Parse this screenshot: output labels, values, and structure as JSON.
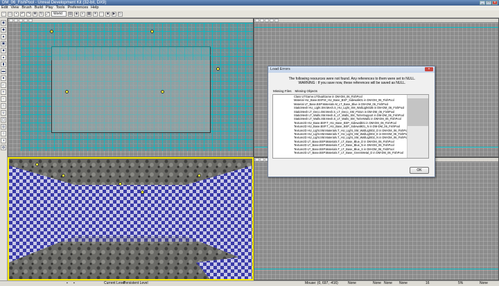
{
  "window": {
    "title": "DM_06_FishPool - Unreal Development Kit (32-bit, DX9)"
  },
  "menu": [
    "Edit",
    "View",
    "Brush",
    "Build",
    "Play",
    "Tools",
    "Preferences",
    "Help"
  ],
  "toolbar": {
    "world_select": "World"
  },
  "dialog": {
    "title": "Load Errors",
    "message_line1": "The following resources were not found. Any references to them were set to NULL.",
    "message_line2": "WARNING : If you save now, these references will be saved as NULL.",
    "tabs": [
      "Missing Files",
      "Missing Objects"
    ],
    "items": [
      "Class UTGame.UTDualGame in DM-DM_06_FishPool",
      "Material HU_Base.BSP.M_HU_Base_BSP_Sidewalk01 in DM-DM_06_FishPool",
      "Material LT_Base.BSP.Materials.M_LT_Base_Blue in DM-DM_06_FishPool",
      "StaticMesh HU_Light.SM.Mesh.S_HU_Light_SM_WallLight02B in DM-DM_06_FishPool",
      "StaticMesh LT_Deco.SM.Mesh.S_LT_Deco_SM_Piston in DM-DM_06_FishPool",
      "StaticMesh LT_Walls.SM.Mesh.S_LT_Walls_SM_TorlerSupport in DM-DM_06_FishPool",
      "StaticMesh LT_Walls.SM.Mesh.S_LT_Walls_SM_TorlerWall1 in DM-DM_06_FishPool",
      "Texture2D HU_Base.BSP.T_HU_Base_BSP_Sidewalk01 in DM-DM_06_FishPool",
      "Texture2D HU_Base.BSP.T_HU_Base_BSP_Sidewalk01_N in DM-DM_06_FishPool",
      "Texture2D HU_Light.SM.Materials.T_HU_Light_SM_WallLight02_D in DM-DM_06_FishPool",
      "Texture2D HU_Light.SM.Materials.T_HU_Light_SM_WallLight02_E in DM-DM_06_FishPool",
      "Texture2D HU_Light.SM.Materials.T_HU_Light_SM_WallLight02_N in DM-DM_06_FishPool",
      "Texture2D LT_Base.BSP.Materials.T_LT_Base_Blue_D in DM-DM_06_FishPool",
      "Texture2D LT_Base.BSP.Materials.T_LT_Base_Blue_N in DM-DM_06_FishPool",
      "Texture2D LT_Base.BSP.Materials.T_LT_Base_Blue_S in DM-DM_06_FishPool",
      "Texture2D LT_Base.BSP.Materials.T_LT_Base_GreenMetal_D in DM-DM_06_FishPool"
    ],
    "ok_label": "OK"
  },
  "status": {
    "current_level_label": "Current Level:",
    "current_level_value": "Persistent Level",
    "mouse": "Mouse: (0, 697, -416)",
    "none_1": "None",
    "none_2": "None",
    "none_3": "None",
    "none_4": "None",
    "grid": "16",
    "snap": "5%",
    "none_5": "None"
  },
  "colors": {
    "viewport_selected": "#ffee00",
    "mesh_wire": "#00bec8",
    "tile_blue": "#3a3aa8"
  }
}
